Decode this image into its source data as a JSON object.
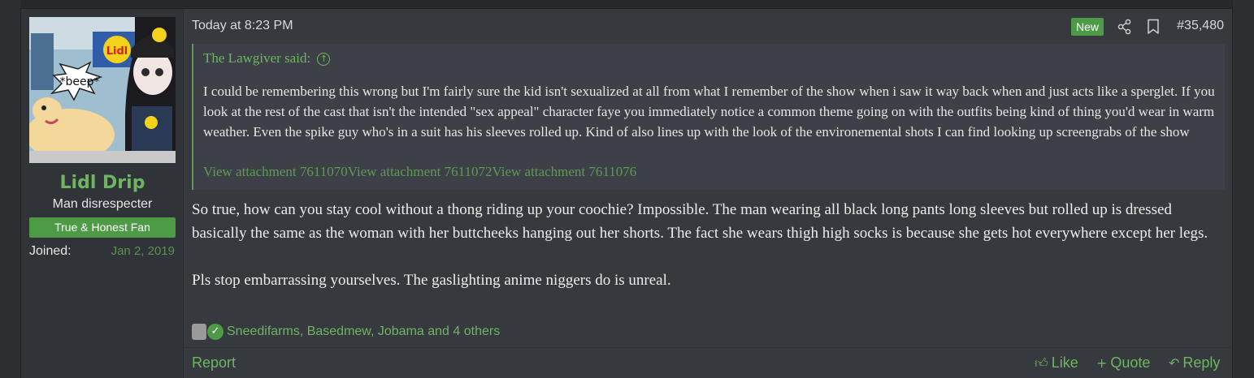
{
  "post": {
    "author": {
      "username": "Lidl Drip",
      "title": "Man disrespecter",
      "badge": "True & Honest Fan",
      "joined_label": "Joined:",
      "joined_value": "Jan 2, 2019",
      "avatar_text": "*beep*",
      "avatar_sign": "Lidl"
    },
    "header": {
      "timestamp": "Today at 8:23 PM",
      "new_label": "New",
      "post_number": "#35,480"
    },
    "quote": {
      "author": "The Lawgiver said:",
      "text": "I could be remembering this wrong but I'm fairly sure the kid isn't sexualized at all from what I remember of the show when i saw it way back when and just acts like a sperglet. If you look at the rest of the cast that isn't the intended \"sex appeal\" character faye you immediately notice a common theme going on with the outfits being kind of thing you'd wear in warm weather. Even the spike guy who's in a suit has his sleeves rolled up. Kind of also lines up with the look of the environemental shots I can find looking up screengrabs of the show",
      "attachments": "View attachment 7611070View attachment 7611072View attachment 7611076"
    },
    "body": {
      "paragraph1": "So true, how can you stay cool without a thong riding up your coochie? Impossible. The man wearing all black long pants long sleeves but rolled up is dressed basically the same as the woman with her buttcheeks hanging out her shorts. The fact she wears thigh high socks is because she gets hot everywhere except her legs.",
      "paragraph2": "Pls stop embarrassing yourselves. The gaslighting anime niggers do is unreal."
    },
    "reactions": {
      "text": "Sneedifarms, Basedmew, Jobama and 4 others",
      "icons": [
        "dumpster-icon",
        "check-icon"
      ]
    },
    "footer": {
      "report": "Report",
      "like": "Like",
      "quote": "Quote",
      "reply": "Reply"
    },
    "colors": {
      "accent": "#6fb461",
      "badge_bg": "#4d9a47",
      "post_bg": "#36393e",
      "quote_bg": "#3d4046"
    }
  }
}
